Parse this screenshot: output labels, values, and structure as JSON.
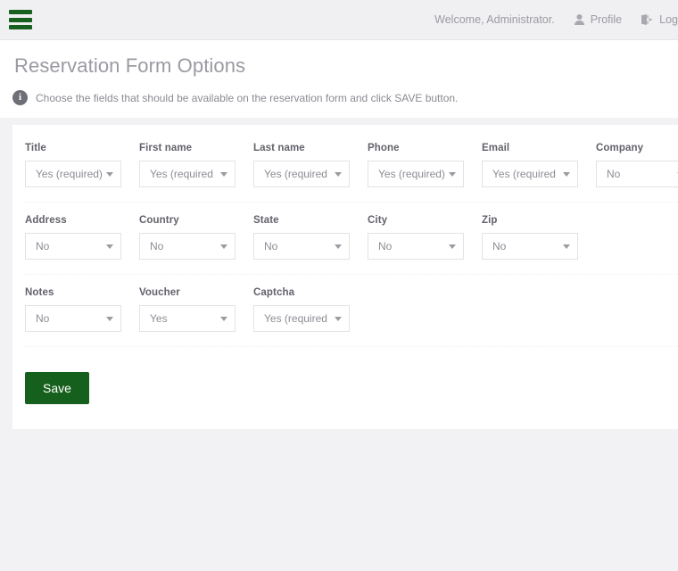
{
  "topbar": {
    "menu_icon": "hamburger-icon",
    "welcome": "Welcome, Administrator.",
    "profile_label": "Profile",
    "profile_icon": "user-icon",
    "logout_label": "Log",
    "logout_icon": "logout-icon"
  },
  "page": {
    "title": "Reservation Form Options",
    "hint_icon": "info-icon",
    "hint_badge": "i",
    "hint": "Choose the fields that should be available on the reservation form and click SAVE button."
  },
  "form": {
    "rows": [
      {
        "fields": [
          {
            "label": "Title",
            "value": "Yes (required)"
          },
          {
            "label": "First name",
            "value": "Yes (required"
          },
          {
            "label": "Last name",
            "value": "Yes (required"
          },
          {
            "label": "Phone",
            "value": "Yes (required)"
          },
          {
            "label": "Email",
            "value": "Yes (required"
          },
          {
            "label": "Company",
            "value": "No"
          }
        ]
      },
      {
        "fields": [
          {
            "label": "Address",
            "value": "No"
          },
          {
            "label": "Country",
            "value": "No"
          },
          {
            "label": "State",
            "value": "No"
          },
          {
            "label": "City",
            "value": "No"
          },
          {
            "label": "Zip",
            "value": "No"
          }
        ]
      },
      {
        "fields": [
          {
            "label": "Notes",
            "value": "No"
          },
          {
            "label": "Voucher",
            "value": "Yes"
          },
          {
            "label": "Captcha",
            "value": "Yes (required"
          }
        ]
      }
    ],
    "save_label": "Save"
  },
  "colors": {
    "brand_green": "#16601d",
    "page_bg": "#f2f2f4",
    "panel_bg": "#ffffff",
    "muted_text": "#9b9ba2"
  }
}
